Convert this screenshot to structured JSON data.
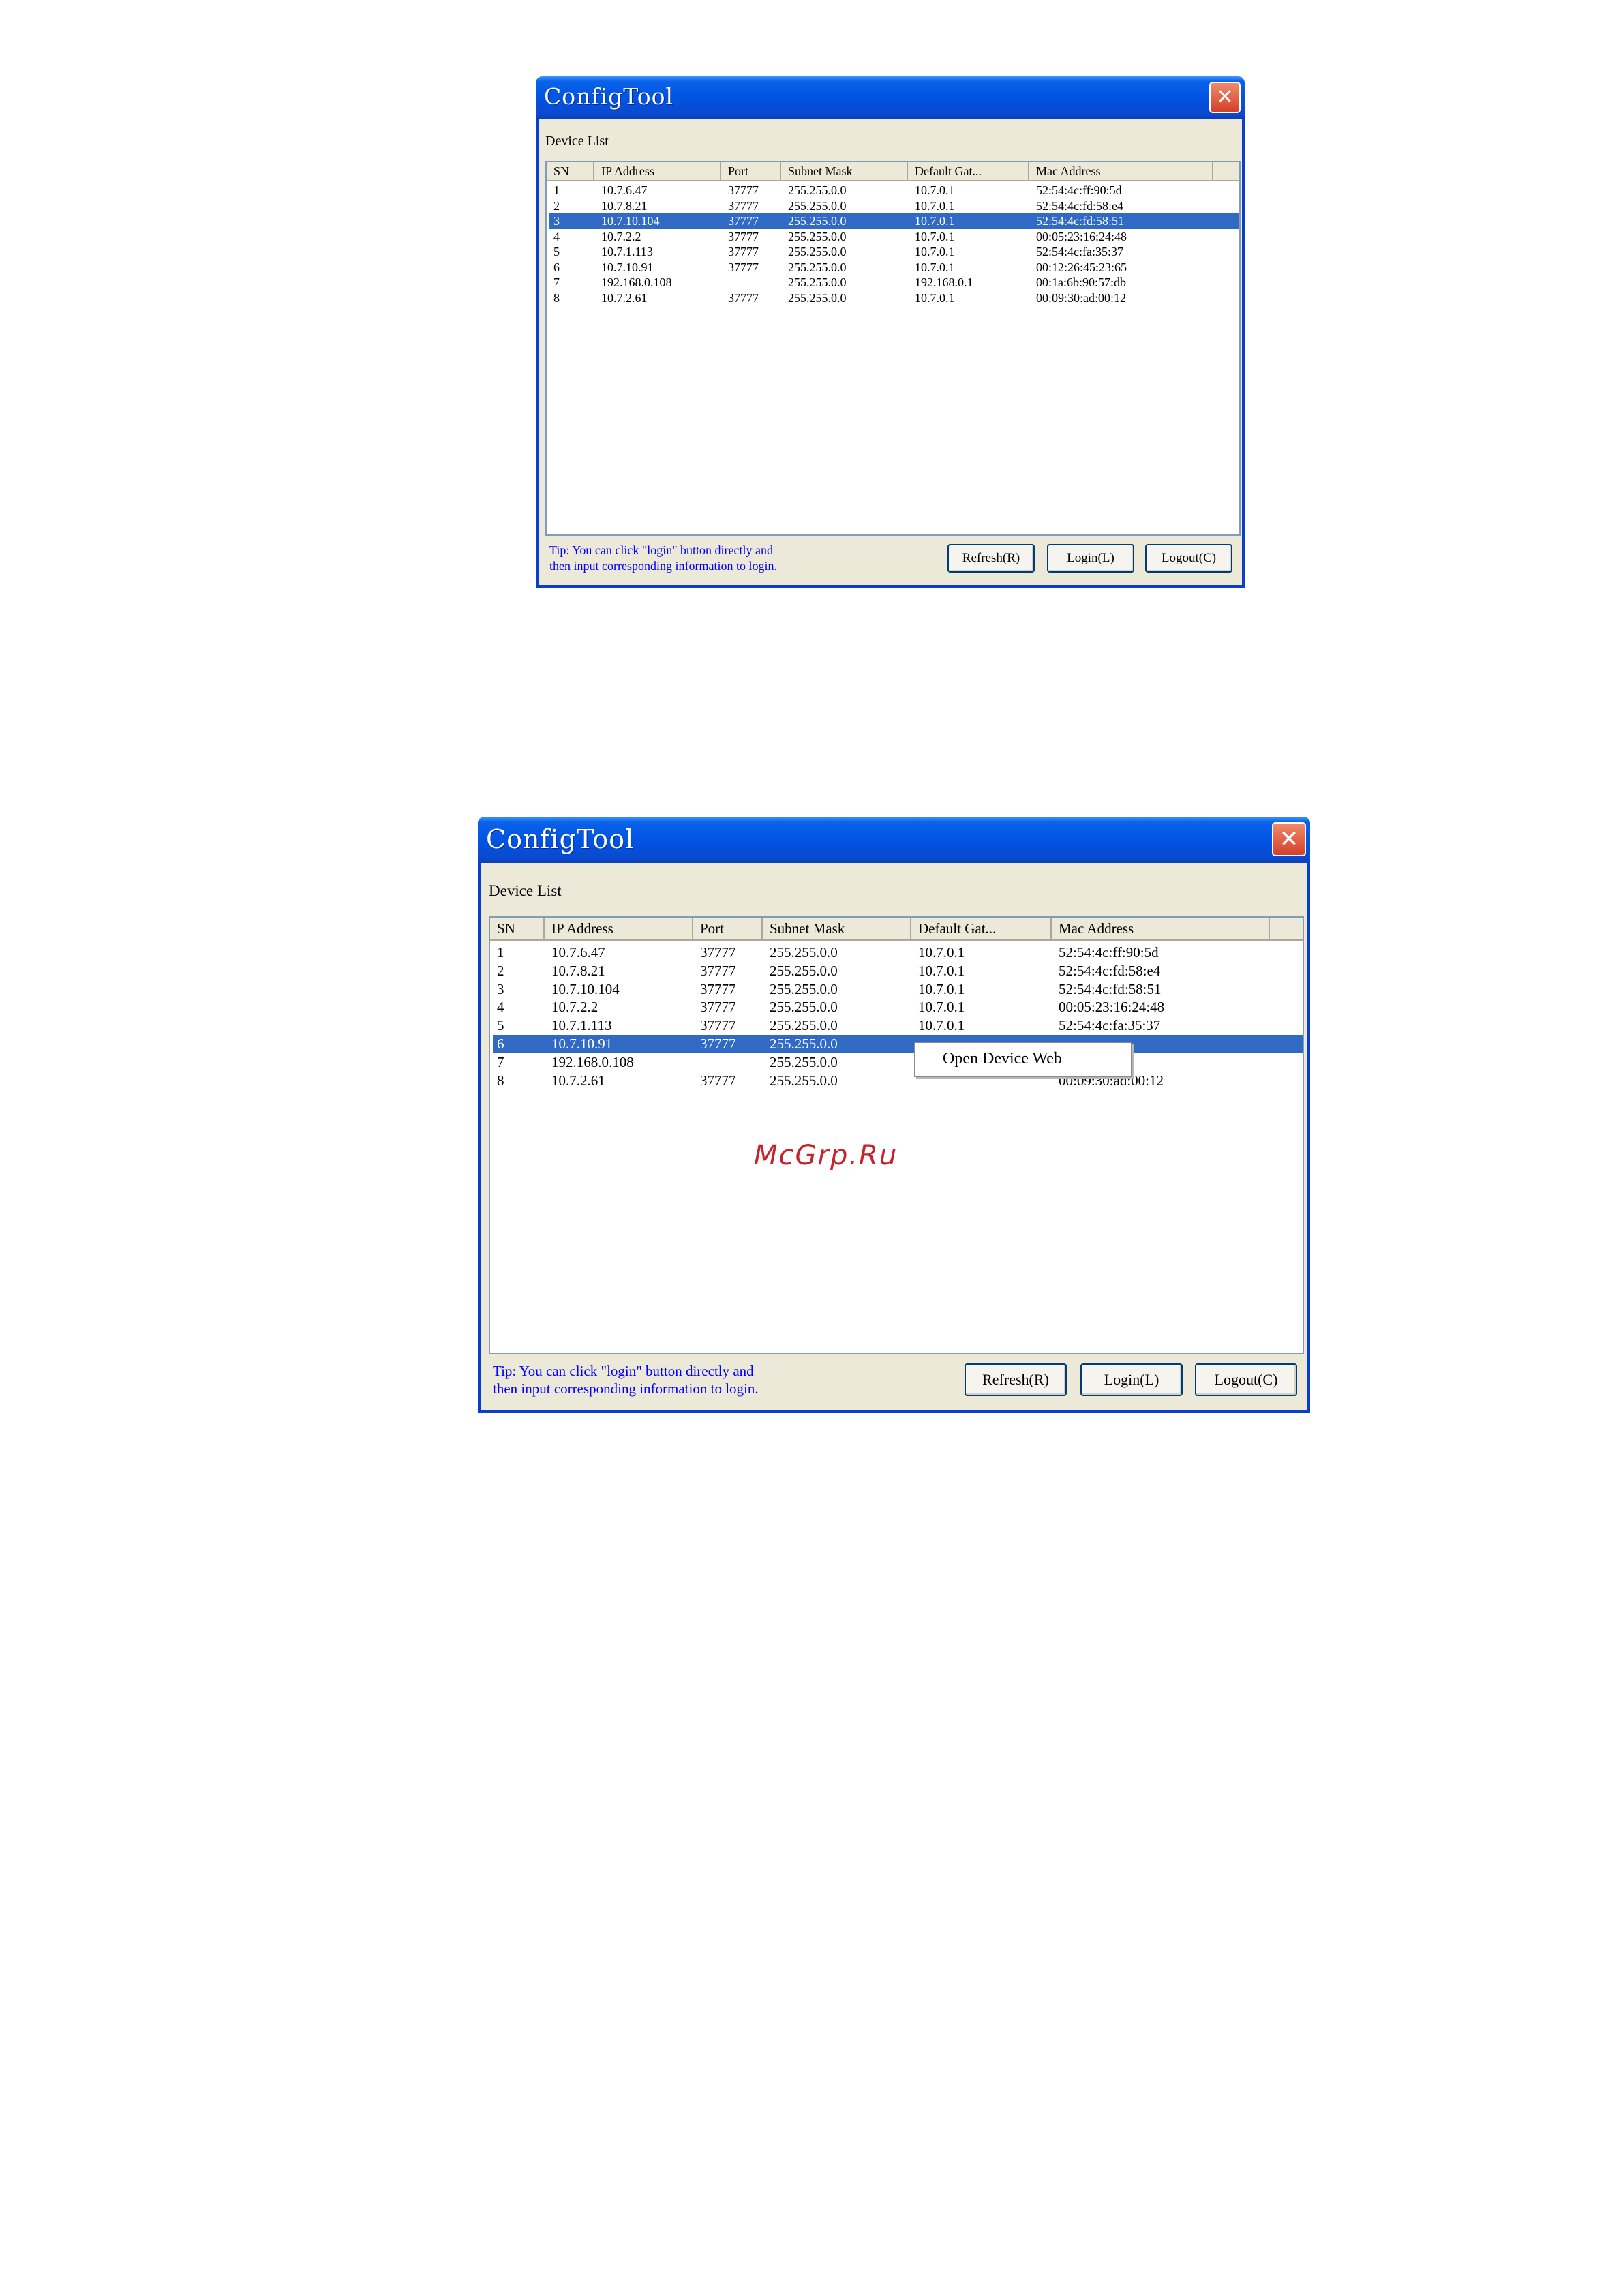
{
  "window_title": "ConfigTool",
  "close_glyph": "✕",
  "group_label": "Device List",
  "columns": [
    "SN",
    "IP Address",
    "Port",
    "Subnet Mask",
    "Default Gat...",
    "Mac Address"
  ],
  "tip_line1": "Tip: You can click \"login\" button directly and",
  "tip_line2": "then input corresponding information to login.",
  "buttons": {
    "refresh": "Refresh(R)",
    "login": "Login(L)",
    "logout": "Logout(C)"
  },
  "screen1": {
    "selected_sn": "3",
    "rows": [
      {
        "sn": "1",
        "ip": "10.7.6.47",
        "port": "37777",
        "mask": "255.255.0.0",
        "gw": "10.7.0.1",
        "mac": "52:54:4c:ff:90:5d"
      },
      {
        "sn": "2",
        "ip": "10.7.8.21",
        "port": "37777",
        "mask": "255.255.0.0",
        "gw": "10.7.0.1",
        "mac": "52:54:4c:fd:58:e4"
      },
      {
        "sn": "3",
        "ip": "10.7.10.104",
        "port": "37777",
        "mask": "255.255.0.0",
        "gw": "10.7.0.1",
        "mac": "52:54:4c:fd:58:51"
      },
      {
        "sn": "4",
        "ip": "10.7.2.2",
        "port": "37777",
        "mask": "255.255.0.0",
        "gw": "10.7.0.1",
        "mac": "00:05:23:16:24:48"
      },
      {
        "sn": "5",
        "ip": "10.7.1.113",
        "port": "37777",
        "mask": "255.255.0.0",
        "gw": "10.7.0.1",
        "mac": "52:54:4c:fa:35:37"
      },
      {
        "sn": "6",
        "ip": "10.7.10.91",
        "port": "37777",
        "mask": "255.255.0.0",
        "gw": "10.7.0.1",
        "mac": "00:12:26:45:23:65"
      },
      {
        "sn": "7",
        "ip": "192.168.0.108",
        "port": "",
        "mask": "255.255.0.0",
        "gw": "192.168.0.1",
        "mac": "00:1a:6b:90:57:db"
      },
      {
        "sn": "8",
        "ip": "10.7.2.61",
        "port": "37777",
        "mask": "255.255.0.0",
        "gw": "10.7.0.1",
        "mac": "00:09:30:ad:00:12"
      }
    ]
  },
  "screen2": {
    "selected_sn": "6",
    "context_menu_item": "Open Device Web",
    "rows": [
      {
        "sn": "1",
        "ip": "10.7.6.47",
        "port": "37777",
        "mask": "255.255.0.0",
        "gw": "10.7.0.1",
        "mac": "52:54:4c:ff:90:5d"
      },
      {
        "sn": "2",
        "ip": "10.7.8.21",
        "port": "37777",
        "mask": "255.255.0.0",
        "gw": "10.7.0.1",
        "mac": "52:54:4c:fd:58:e4"
      },
      {
        "sn": "3",
        "ip": "10.7.10.104",
        "port": "37777",
        "mask": "255.255.0.0",
        "gw": "10.7.0.1",
        "mac": "52:54:4c:fd:58:51"
      },
      {
        "sn": "4",
        "ip": "10.7.2.2",
        "port": "37777",
        "mask": "255.255.0.0",
        "gw": "10.7.0.1",
        "mac": "00:05:23:16:24:48"
      },
      {
        "sn": "5",
        "ip": "10.7.1.113",
        "port": "37777",
        "mask": "255.255.0.0",
        "gw": "10.7.0.1",
        "mac": "52:54:4c:fa:35:37"
      },
      {
        "sn": "6",
        "ip": "10.7.10.91",
        "port": "37777",
        "mask": "255.255.0.0",
        "gw": "",
        "mac": ""
      },
      {
        "sn": "7",
        "ip": "192.168.0.108",
        "port": "",
        "mask": "255.255.0.0",
        "gw": "",
        "mac": ":90:57:db"
      },
      {
        "sn": "8",
        "ip": "10.7.2.61",
        "port": "37777",
        "mask": "255.255.0.0",
        "gw": "",
        "mac": "00:09:30:ad:00:12"
      }
    ]
  },
  "watermark": "McGrp.Ru",
  "colors": {
    "title_bar": "#0054e3",
    "selection": "#316ac5",
    "tip_text": "#0000ff",
    "watermark": "#c4242b"
  }
}
